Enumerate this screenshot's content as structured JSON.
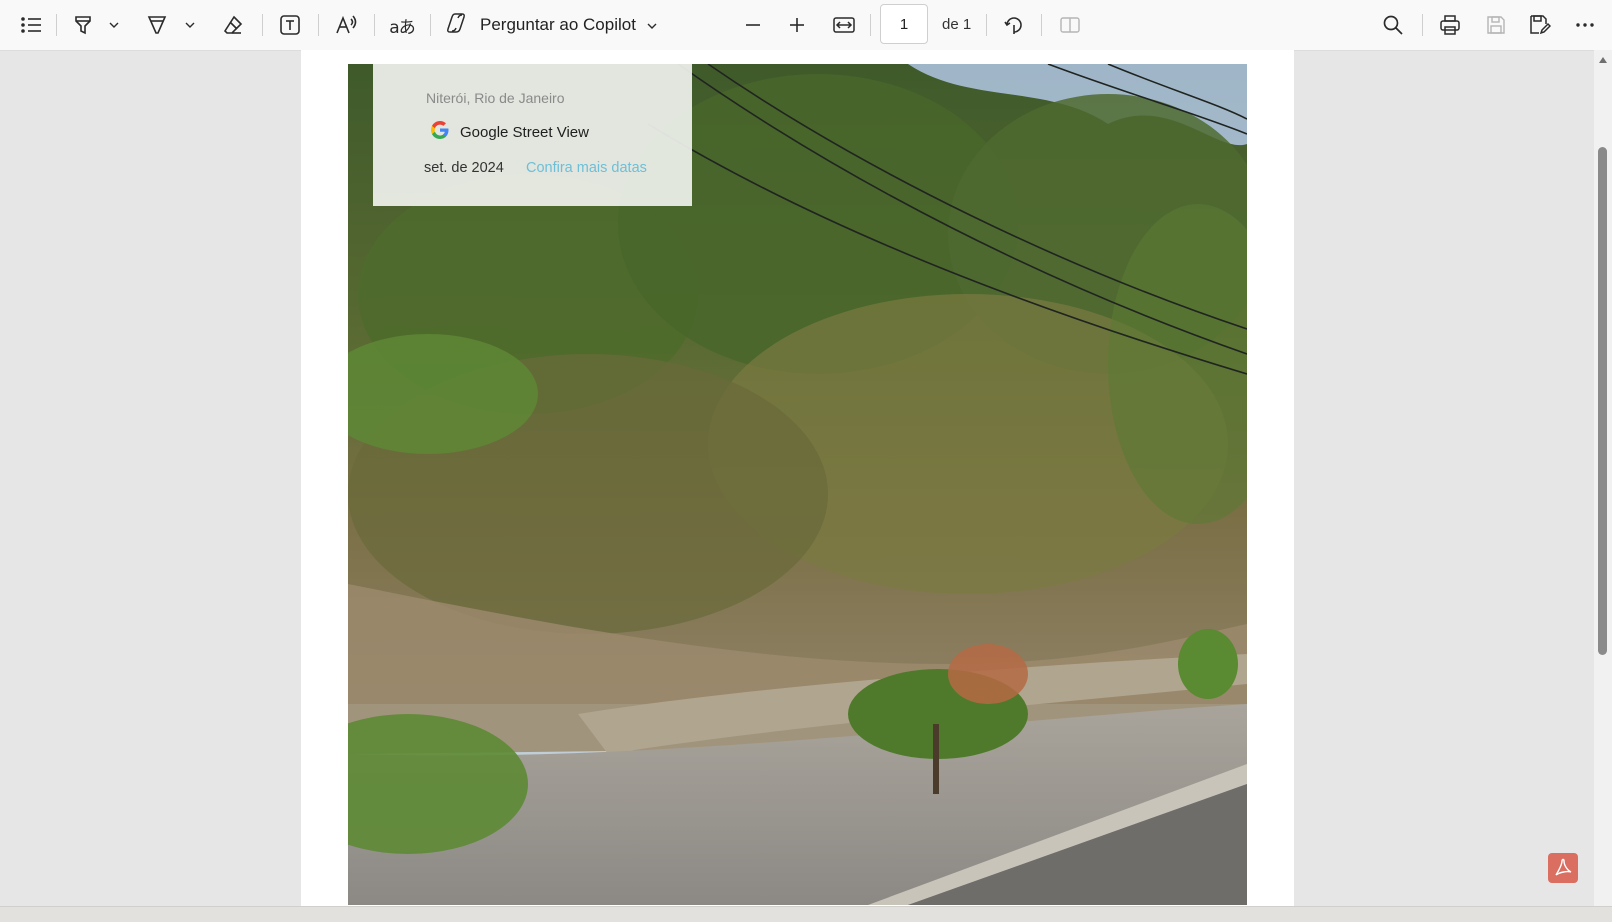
{
  "toolbar": {
    "copilot_label": "Perguntar ao Copilot",
    "page_current": "1",
    "page_total": "de 1",
    "icons": [
      "list-icon",
      "highlighter-icon",
      "chevron-down-icon",
      "draw-icon",
      "chevron-down-icon",
      "eraser-icon",
      "text-box-icon",
      "read-aloud-icon",
      "translate-icon",
      "copilot-icon",
      "chevron-down-icon",
      "zoom-out-icon",
      "zoom-in-icon",
      "fit-width-icon",
      "rotate-icon",
      "two-page-icon",
      "search-icon",
      "print-icon",
      "save-icon",
      "save-as-icon",
      "more-icon"
    ]
  },
  "streetview": {
    "location": "Niterói, Rio de Janeiro",
    "brand": "Google Street View",
    "date": "set. de 2024",
    "more_dates": "Confira mais datas"
  },
  "colors": {
    "toolbar_bg": "#f9f9f9",
    "viewer_bg": "#e6e6e6",
    "link": "#6dbfd8",
    "pdf_badge": "#d96e61"
  }
}
